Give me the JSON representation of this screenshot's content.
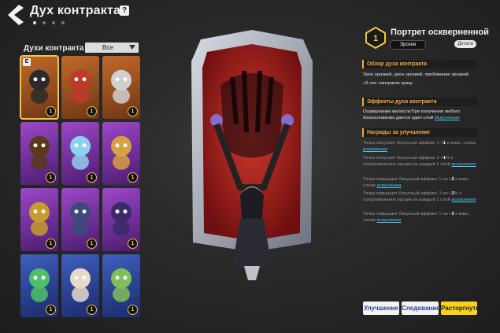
{
  "header": {
    "title": "Дух контракта",
    "help": "?"
  },
  "left": {
    "label": "Духи контракта",
    "filter": "Все",
    "cards": [
      {
        "level": "1",
        "tag": "E",
        "bg": "bg-brown"
      },
      {
        "level": "1",
        "tag": "",
        "bg": "bg-brown"
      },
      {
        "level": "1",
        "tag": "",
        "bg": "bg-brown"
      },
      {
        "level": "1",
        "tag": "",
        "bg": "bg-purple"
      },
      {
        "level": "1",
        "tag": "",
        "bg": "bg-purple"
      },
      {
        "level": "1",
        "tag": "",
        "bg": "bg-purple"
      },
      {
        "level": "1",
        "tag": "",
        "bg": "bg-purple"
      },
      {
        "level": "1",
        "tag": "",
        "bg": "bg-purple"
      },
      {
        "level": "1",
        "tag": "",
        "bg": "bg-purple"
      },
      {
        "level": "1",
        "tag": "",
        "bg": "bg-blue"
      },
      {
        "level": "1",
        "tag": "",
        "bg": "bg-blue"
      },
      {
        "level": "1",
        "tag": "",
        "bg": "bg-blue"
      }
    ]
  },
  "detail": {
    "level": "1",
    "name": "Портрет оскверненной",
    "chip": "Эрозия",
    "details_btn": "Детали",
    "overview_head": "Обзор духа контракта",
    "overview_1": "Урон эрозией, урон эрозией, пробивание эрозией",
    "overview_2": "+2 очк. контракта сразу",
    "effects_head": "Эффекты духа контракта",
    "effects_pre": "Осквернение милости:При получении любого благословения дается один слой ",
    "effects_link": "Искупление",
    "rewards_head": "Награды за улучшение",
    "r1_a": "Точка получает бонусный аффикс 1 +",
    "r1_b": "1",
    "r1_c": " и макс. слоев ",
    "r1_link": "искупления",
    "r2_a": "Точка получает бонусный аффикс 2 +",
    "r2_b": "1",
    "r2_c": "% к сопротивлению эрозии за каждый 1 слой ",
    "r2_link": "искупления",
    "r3_a": "Точка повышает бонусный аффикс 1 на +",
    "r3_b": "2",
    "r3_c": " к макс. слоев ",
    "r3_link": "искупления",
    "r4_a": "Точка повышает бонусный аффикс 2 на +",
    "r4_b": "3",
    "r4_c": "% к сопротивлению эрозии за каждый 1 слой ",
    "r4_link": "искупления",
    "r5_a": "Точка повышает бонусный аффикс 1 на +",
    "r5_b": "3",
    "r5_c": " к макс. слоев ",
    "r5_link": "искупления"
  },
  "buttons": {
    "upgrade": "Улучшение",
    "follow": "Следование",
    "disband": "Расторгнуть"
  },
  "colors": {
    "accent": "#f2a93a",
    "link": "#4ec7f0",
    "primary": "#f6d21a"
  }
}
